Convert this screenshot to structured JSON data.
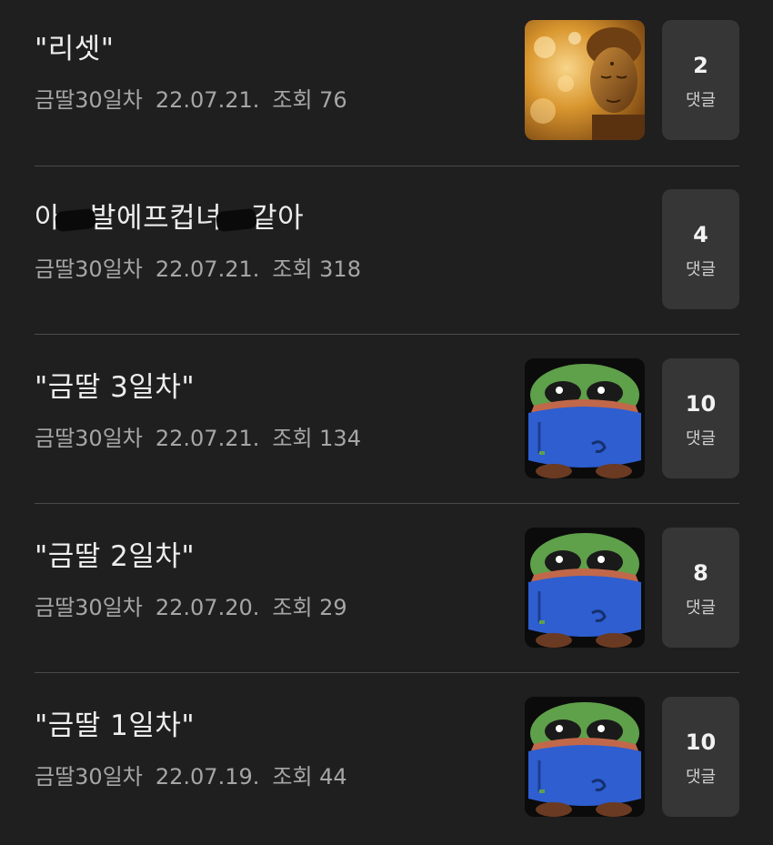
{
  "posts": [
    {
      "title": "\"리셋\"",
      "author": "금딸30일차",
      "date": "22.07.21.",
      "views_label": "조회 76",
      "thumbnail": "buddha-statue-image",
      "comments": "2",
      "comments_label": "댓글"
    },
    {
      "title_parts": [
        "아",
        "발에프컵녀",
        "같아"
      ],
      "author": "금딸30일차",
      "date": "22.07.21.",
      "views_label": "조회 318",
      "thumbnail": null,
      "comments": "4",
      "comments_label": "댓글"
    },
    {
      "title": "\"금딸 3일차\"",
      "author": "금딸30일차",
      "date": "22.07.21.",
      "views_label": "조회 134",
      "thumbnail": "pepe-blanket-image",
      "comments": "10",
      "comments_label": "댓글"
    },
    {
      "title": "\"금딸 2일차\"",
      "author": "금딸30일차",
      "date": "22.07.20.",
      "views_label": "조회 29",
      "thumbnail": "pepe-blanket-image",
      "comments": "8",
      "comments_label": "댓글"
    },
    {
      "title": "\"금딸 1일차\"",
      "author": "금딸30일차",
      "date": "22.07.19.",
      "views_label": "조회 44",
      "thumbnail": "pepe-blanket-image",
      "comments": "10",
      "comments_label": "댓글"
    }
  ],
  "colors": {
    "background": "#1f1f1f",
    "comment_box": "#363636",
    "meta_text": "#a6a6a6"
  }
}
